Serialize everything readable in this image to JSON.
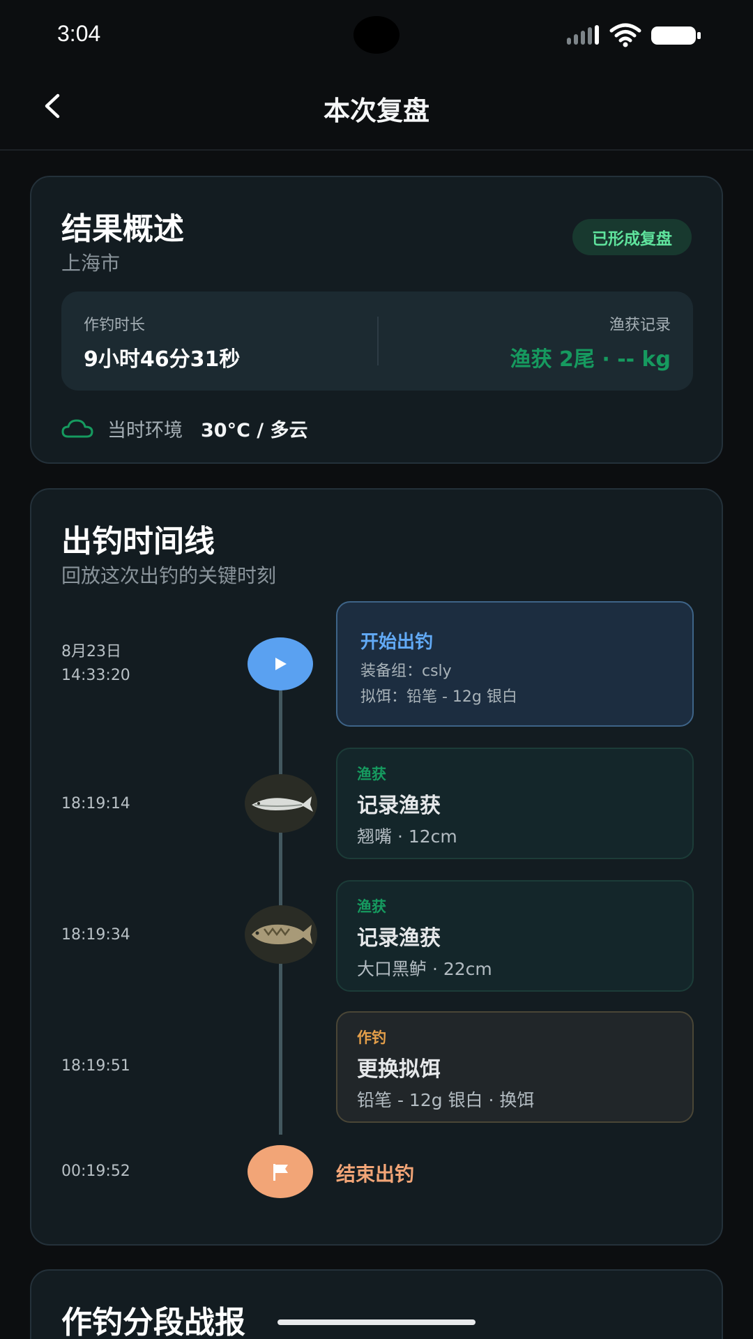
{
  "status_bar": {
    "time": "3:04"
  },
  "header": {
    "title": "本次复盘",
    "back_icon": "chevron-left-icon"
  },
  "summary": {
    "title": "结果概述",
    "location": "上海市",
    "badge": "已形成复盘",
    "duration_label": "作钓时长",
    "duration_value": "9小时46分31秒",
    "catch_label": "渔获记录",
    "catch_value": "渔获 2尾 · -- kg",
    "env_label": "当时环境",
    "env_value": "30°C / 多云",
    "env_icon": "cloud-icon"
  },
  "timeline": {
    "title": "出钓时间线",
    "subtitle": "回放这次出钓的关键时刻",
    "events": [
      {
        "date": "8月23日",
        "time": "14:33:20",
        "title": "开始出钓",
        "detail1": "装备组：csly",
        "detail2": "拟饵：铅笔 - 12g 银白",
        "icon": "play-icon"
      },
      {
        "time": "18:19:14",
        "tag": "渔获",
        "title": "记录渔获",
        "detail": "翘嘴 · 12cm",
        "icon": "fish-icon"
      },
      {
        "time": "18:19:34",
        "tag": "渔获",
        "title": "记录渔获",
        "detail": "大口黑鲈 · 22cm",
        "icon": "bass-icon"
      },
      {
        "time": "18:19:51",
        "tag": "作钓",
        "title": "更换拟饵",
        "detail": "铅笔 - 12g 银白 · 换饵"
      },
      {
        "time": "00:19:52",
        "title": "结束出钓",
        "icon": "flag-icon"
      }
    ]
  },
  "report": {
    "title": "作钓分段战报"
  },
  "colors": {
    "accent_green": "#169a5f",
    "accent_blue": "#5aa1f1",
    "accent_orange": "#f2a577",
    "badge_text": "#5fe39d"
  }
}
